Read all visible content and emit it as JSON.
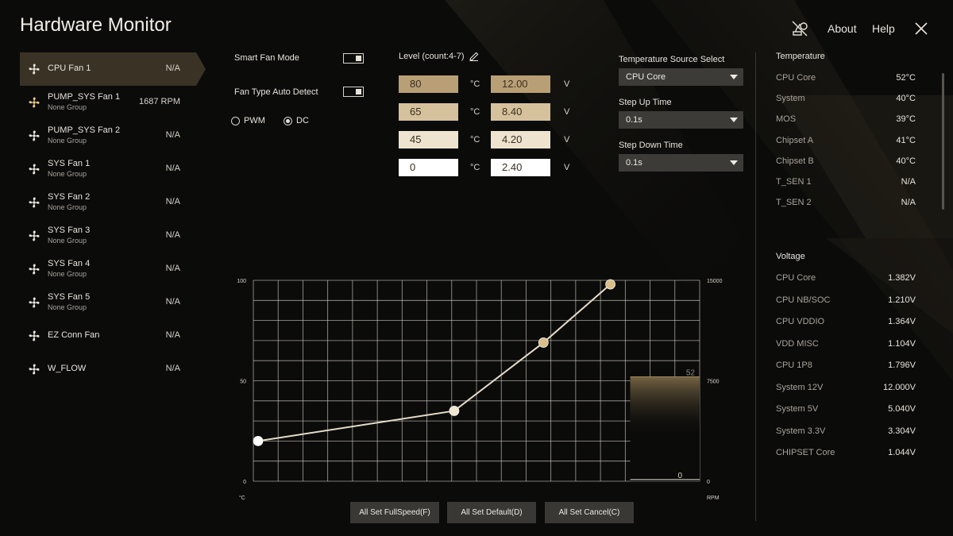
{
  "app": {
    "title": "Hardware Monitor"
  },
  "header": {
    "about_label": "About",
    "help_label": "Help"
  },
  "fans": [
    {
      "name": "CPU Fan 1",
      "group": "",
      "value": "N/A",
      "active": true
    },
    {
      "name": "PUMP_SYS Fan 1",
      "group": "None Group",
      "value": "1687 RPM",
      "spinning": true
    },
    {
      "name": "PUMP_SYS Fan 2",
      "group": "None Group",
      "value": "N/A"
    },
    {
      "name": "SYS Fan 1",
      "group": "None Group",
      "value": "N/A"
    },
    {
      "name": "SYS Fan 2",
      "group": "None Group",
      "value": "N/A"
    },
    {
      "name": "SYS Fan 3",
      "group": "None Group",
      "value": "N/A"
    },
    {
      "name": "SYS Fan 4",
      "group": "None Group",
      "value": "N/A"
    },
    {
      "name": "SYS Fan 5",
      "group": "None Group",
      "value": "N/A"
    },
    {
      "name": "EZ Conn Fan",
      "group": "",
      "value": "N/A"
    },
    {
      "name": "W_FLOW",
      "group": "",
      "value": "N/A"
    }
  ],
  "controls": {
    "smart_fan_mode": "Smart Fan Mode",
    "fan_type_auto_detect": "Fan Type Auto Detect",
    "pwm": "PWM",
    "dc": "DC",
    "level_label": "Level (count:4-7)",
    "temp_unit": "°C",
    "volt_unit": "V",
    "levels": [
      {
        "temp": "80",
        "volt": "12.00"
      },
      {
        "temp": "65",
        "volt": "8.40"
      },
      {
        "temp": "45",
        "volt": "4.20"
      },
      {
        "temp": "0",
        "volt": "2.40"
      }
    ],
    "temp_source_label": "Temperature Source Select",
    "temp_source_value": "CPU Core",
    "step_up_label": "Step Up Time",
    "step_up_value": "0.1s",
    "step_down_label": "Step Down Time",
    "step_down_value": "0.1s"
  },
  "temperature": {
    "title": "Temperature",
    "rows": [
      {
        "k": "CPU Core",
        "v": "52°C"
      },
      {
        "k": "System",
        "v": "40°C"
      },
      {
        "k": "MOS",
        "v": "39°C"
      },
      {
        "k": "Chipset A",
        "v": "41°C"
      },
      {
        "k": "Chipset B",
        "v": "40°C"
      },
      {
        "k": "T_SEN 1",
        "v": "N/A"
      },
      {
        "k": "T_SEN 2",
        "v": "N/A"
      }
    ]
  },
  "voltage": {
    "title": "Voltage",
    "rows": [
      {
        "k": "CPU Core",
        "v": "1.382V"
      },
      {
        "k": "CPU NB/SOC",
        "v": "1.210V"
      },
      {
        "k": "CPU VDDIO",
        "v": "1.364V"
      },
      {
        "k": "VDD MISC",
        "v": "1.104V"
      },
      {
        "k": "CPU 1P8",
        "v": "1.796V"
      },
      {
        "k": "System 12V",
        "v": "12.000V"
      },
      {
        "k": "System 5V",
        "v": "5.040V"
      },
      {
        "k": "System 3.3V",
        "v": "3.304V"
      },
      {
        "k": "CHIPSET Core",
        "v": "1.044V"
      }
    ]
  },
  "buttons": {
    "full_speed": "All Set FullSpeed(F)",
    "default": "All Set Default(D)",
    "cancel": "All Set Cancel(C)"
  },
  "chart_data": {
    "type": "line",
    "left_axis": {
      "unit": "°C",
      "ticks": [
        "0",
        "50",
        "100"
      ],
      "range": [
        0,
        100
      ]
    },
    "right_axis": {
      "unit": "RPM",
      "ticks": [
        "0",
        "7500",
        "15000"
      ],
      "range": [
        0,
        15000
      ]
    },
    "x_range": [
      0,
      100
    ],
    "points": [
      {
        "x": 0,
        "y": 20
      },
      {
        "x": 45,
        "y": 35
      },
      {
        "x": 65,
        "y": 69
      },
      {
        "x": 80,
        "y": 98
      }
    ],
    "current_temp": {
      "label": "52",
      "value": 52
    },
    "current_rpm": {
      "label": "0",
      "value": 0
    },
    "colors": {
      "line": "#e6dcc8",
      "point": "#d9be8a",
      "grid": "#d8d3c9"
    }
  },
  "colors": {
    "accent": "#c8aa72",
    "active_bg": "#3a3225"
  }
}
